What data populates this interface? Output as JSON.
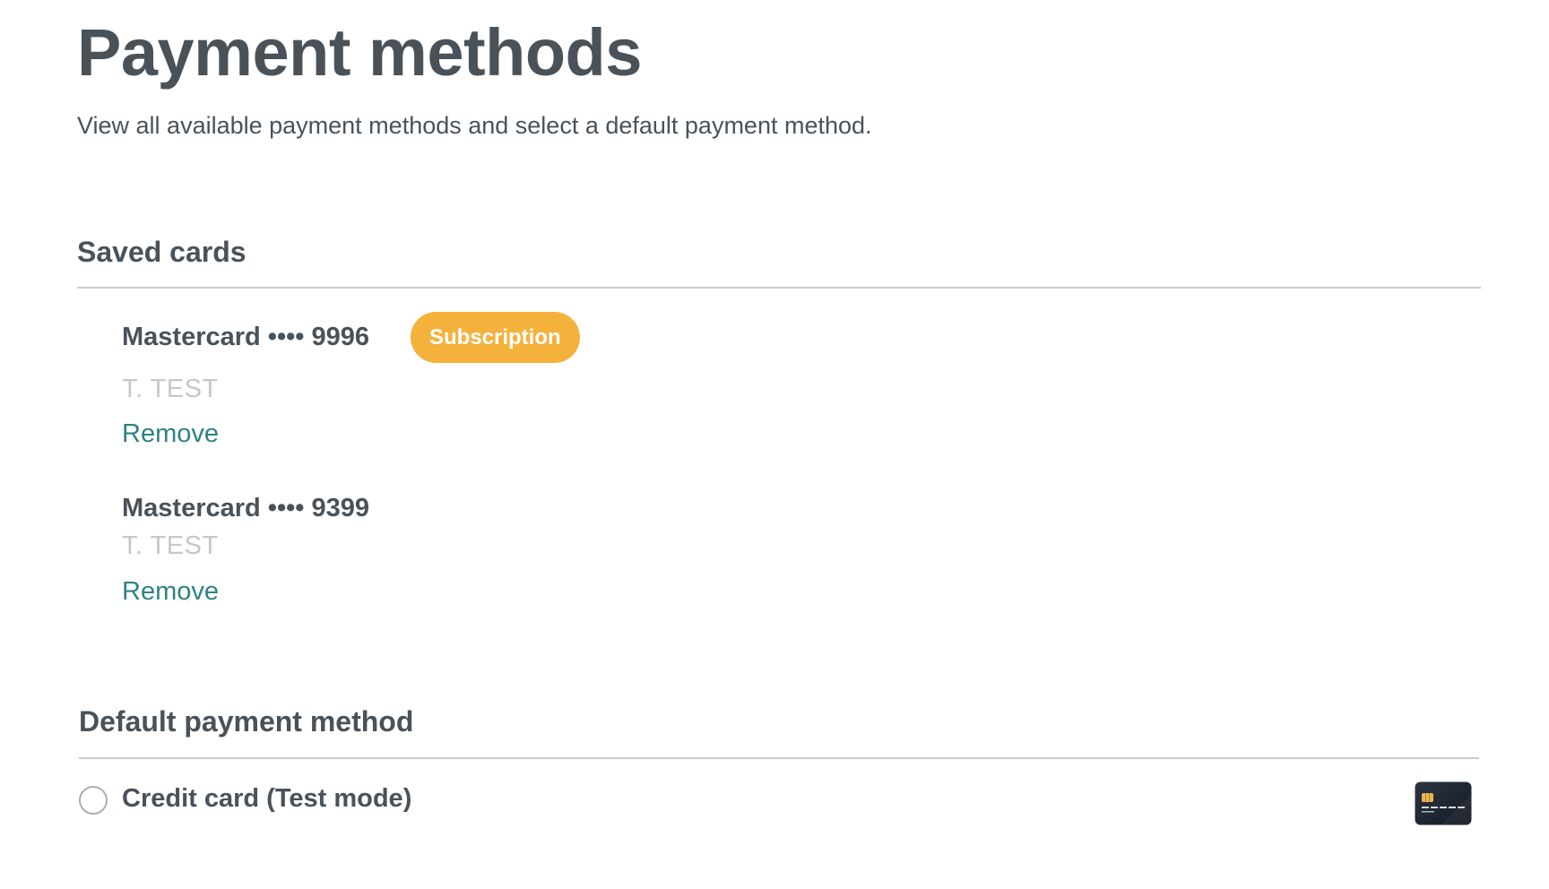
{
  "header": {
    "title": "Payment methods",
    "subtitle": "View all available payment methods and select a default payment method."
  },
  "saved_cards": {
    "heading": "Saved cards",
    "cards": [
      {
        "title": "Mastercard •••• 9996",
        "badge": "Subscription",
        "holder": "T. TEST",
        "remove_label": "Remove"
      },
      {
        "title": "Mastercard •••• 9399",
        "holder": "T. TEST",
        "remove_label": "Remove"
      }
    ]
  },
  "default_method": {
    "heading": "Default payment method",
    "options": [
      {
        "label": "Credit card (Test mode)",
        "selected": false,
        "icon": "credit-card-icon"
      }
    ]
  },
  "colors": {
    "text": "#4a5259",
    "muted": "#c5c8cb",
    "link": "#2f8284",
    "badge": "#f4b23c",
    "divider": "#c9ccd0"
  }
}
